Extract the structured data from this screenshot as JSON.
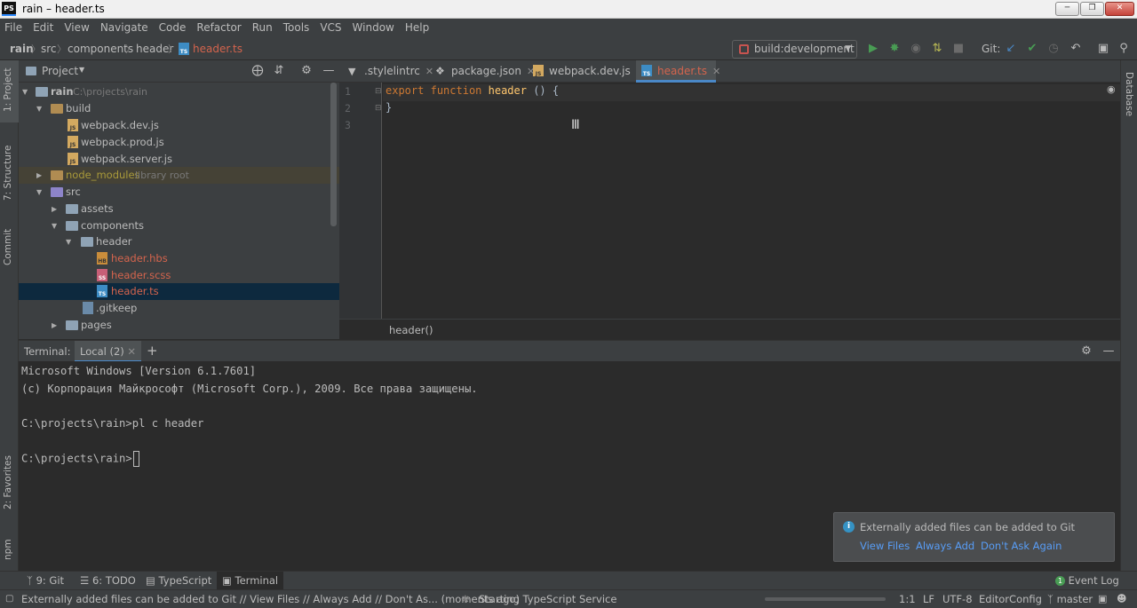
{
  "window": {
    "title": "rain – header.ts",
    "logo": "PS",
    "controls": [
      "minimize",
      "restore",
      "close"
    ]
  },
  "menu": [
    "File",
    "Edit",
    "View",
    "Navigate",
    "Code",
    "Refactor",
    "Run",
    "Tools",
    "VCS",
    "Window",
    "Help"
  ],
  "breadcrumbs": [
    "rain",
    "src",
    "components",
    "header",
    "header.ts"
  ],
  "run_config": "build:development",
  "git_label": "Git:",
  "project_panel": {
    "title": "Project"
  },
  "tree": [
    {
      "label": "rain",
      "hint": "C:\\projects\\rain"
    },
    {
      "label": "build"
    },
    {
      "label": "webpack.dev.js"
    },
    {
      "label": "webpack.prod.js"
    },
    {
      "label": "webpack.server.js"
    },
    {
      "label": "node_modules",
      "hint": "library root"
    },
    {
      "label": "src"
    },
    {
      "label": "assets"
    },
    {
      "label": "components"
    },
    {
      "label": "header"
    },
    {
      "label": "header.hbs"
    },
    {
      "label": "header.scss"
    },
    {
      "label": "header.ts"
    },
    {
      "label": ".gitkeep"
    },
    {
      "label": "pages"
    }
  ],
  "tabs": [
    ".stylelintrc",
    "package.json",
    "webpack.dev.js",
    "header.ts"
  ],
  "editor": {
    "line_numbers": [
      "1",
      "2",
      "3"
    ],
    "kw1": "export",
    "kw2": "function",
    "fn": "header",
    "rest": " () {",
    "line2": "}",
    "breadcrumb": "header()"
  },
  "side_left": {
    "project": "1: Project",
    "structure": "7: Structure",
    "commit": "Commit",
    "favorites": "2: Favorites",
    "npm": "npm"
  },
  "side_right": {
    "database": "Database"
  },
  "terminal": {
    "label": "Terminal:",
    "tab": "Local (2)",
    "lines": [
      "Microsoft Windows [Version 6.1.7601]",
      "(c) Корпорация Майкрософт (Microsoft Corp.), 2009. Все права защищены.",
      "",
      "C:\\projects\\rain>pl c header",
      "",
      "C:\\projects\\rain>"
    ]
  },
  "notification": {
    "message": "Externally added files can be added to Git",
    "actions": [
      "View Files",
      "Always Add",
      "Don't Ask Again"
    ]
  },
  "bottom_tabs": {
    "git": "9: Git",
    "todo": "6: TODO",
    "typescript": "TypeScript",
    "terminal": "Terminal",
    "event_log": "Event Log"
  },
  "status": {
    "message": "Externally added files can be added to Git // View Files // Always Add // Don't As... (moments ago)",
    "service": "Starting TypeScript Service",
    "position": "1:1",
    "line_sep": "LF",
    "encoding": "UTF-8",
    "editorconfig": "EditorConfig",
    "branch": "master"
  },
  "colors": {
    "accent": "#4a88c7",
    "keyword": "#cc7832",
    "function": "#ffc66d",
    "modified_file": "#d4644d",
    "link": "#589df6"
  }
}
